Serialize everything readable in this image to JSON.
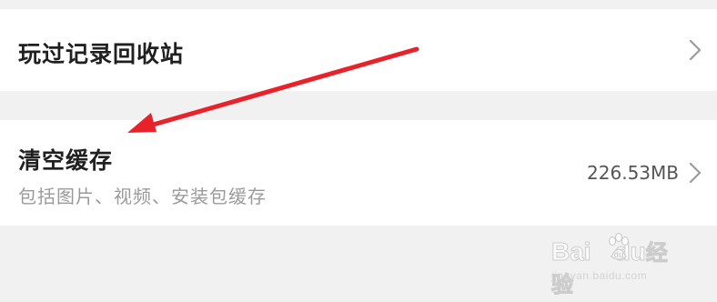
{
  "settings": {
    "recycle_bin": {
      "title": "玩过记录回收站"
    },
    "clear_cache": {
      "title": "清空缓存",
      "subtitle": "包括图片、视频、安装包缓存",
      "size": "226.53MB"
    }
  },
  "annotation": {
    "color": "#e8222a"
  },
  "watermark": {
    "logo_left": "Bai",
    "logo_right": "du",
    "logo_cn": "经验",
    "url": "jingyan.baidu.com"
  }
}
